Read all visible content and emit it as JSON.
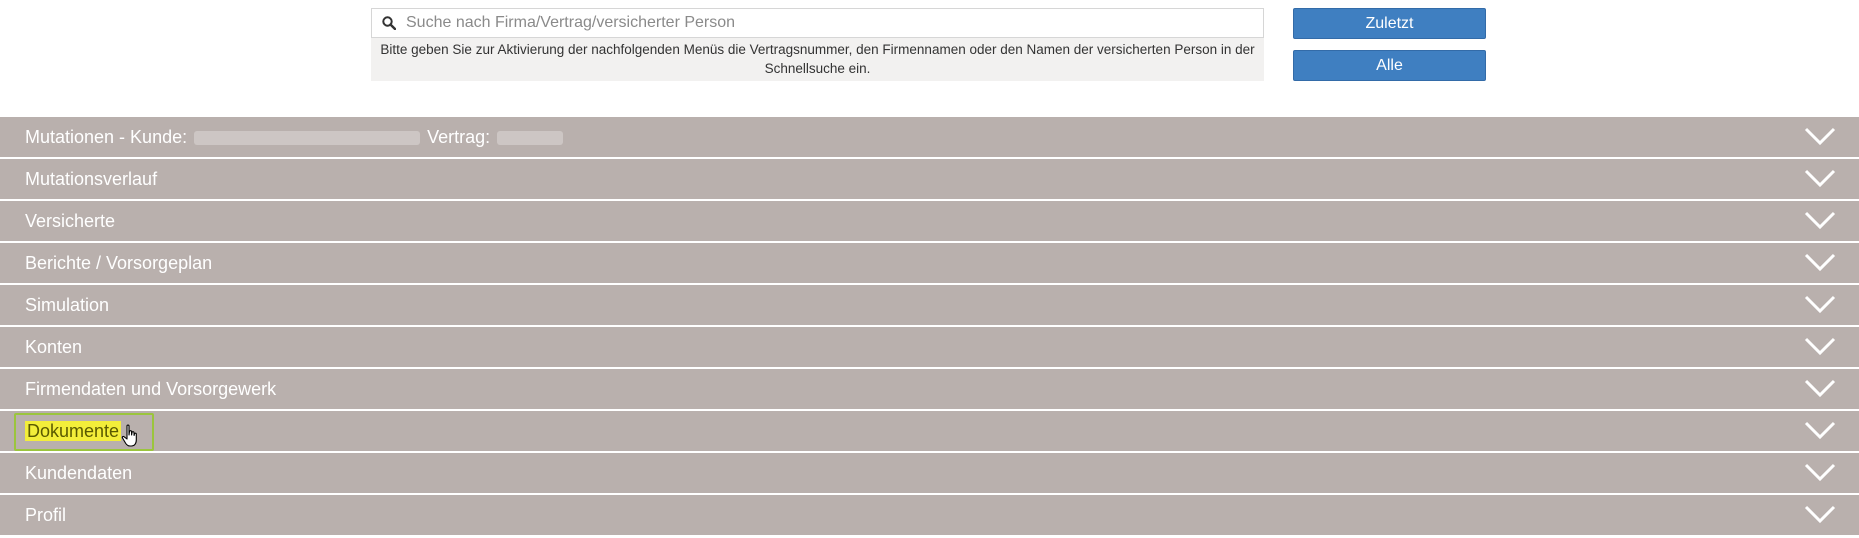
{
  "search": {
    "placeholder": "Suche nach Firma/Vertrag/versicherter Person",
    "hint": "Bitte geben Sie zur Aktivierung der nachfolgenden Menüs die Vertragsnummer, den Firmennamen oder den Namen der versicherten Person in der Schnellsuche ein."
  },
  "buttons": {
    "recent": "Zuletzt",
    "all": "Alle"
  },
  "accordion": {
    "header_prefix": "Mutationen - Kunde:",
    "header_contract_label": "Vertrag:",
    "items": [
      {
        "label": "Mutationsverlauf"
      },
      {
        "label": "Versicherte"
      },
      {
        "label": "Berichte / Vorsorgeplan"
      },
      {
        "label": "Simulation"
      },
      {
        "label": "Konten"
      },
      {
        "label": "Firmendaten und Vorsorgewerk"
      },
      {
        "label": "Dokumente"
      },
      {
        "label": "Kundendaten"
      },
      {
        "label": "Profil"
      }
    ]
  },
  "icons": {
    "search": "search-icon",
    "expand": "chevron-down-icon",
    "pointer": "hand-cursor-icon"
  },
  "colors": {
    "accordion_bg": "#b9b0ad",
    "button_bg": "#3f7fc1",
    "highlight_border": "#9bc53d",
    "highlight_fill": "#f3ee3a"
  }
}
